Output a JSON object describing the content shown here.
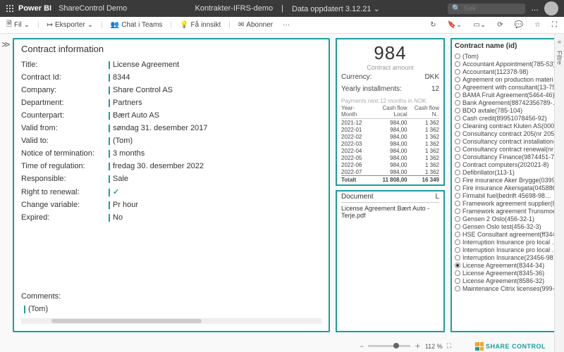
{
  "topbar": {
    "product": "Power BI",
    "workspace": "ShareControl Demo",
    "report_name": "Kontrakter-IFRS-demo",
    "data_updated_label": "Data oppdatert 3.12.21",
    "search_placeholder": "Søk",
    "more": "…"
  },
  "toolbar": {
    "file": "Fil",
    "export": "Eksporter",
    "chat": "Chat i Teams",
    "insight": "Få innsikt",
    "subscribe": "Abonner",
    "more": "···"
  },
  "contract_info": {
    "heading": "Contract information",
    "fields": [
      {
        "label": "Title:",
        "value": "License Agreement"
      },
      {
        "label": "Contract Id:",
        "value": "8344"
      },
      {
        "label": "Company:",
        "value": "Share Control AS"
      },
      {
        "label": "Department:",
        "value": "Partners"
      },
      {
        "label": "Counterpart:",
        "value": "Bært Auto AS"
      },
      {
        "label": "Valid from:",
        "value": "søndag 31. desember 2017"
      },
      {
        "label": "Valid to:",
        "value": "(Tom)"
      },
      {
        "label": "Notice of termination:",
        "value": "3 months"
      },
      {
        "label": "Time of regulation:",
        "value": "fredag 30. desember 2022"
      },
      {
        "label": "Responsible:",
        "value": "Sale"
      },
      {
        "label": "Right to renewal:",
        "value": "✓",
        "isCheck": true
      },
      {
        "label": "Change variable:",
        "value": "Pr hour"
      },
      {
        "label": "Expired:",
        "value": "No"
      }
    ],
    "comments_label": "Comments:",
    "comments_value": "(Tom)"
  },
  "kpi": {
    "value": "984",
    "label": "Contract amount",
    "currency_label": "Currency:",
    "currency_value": "DKK",
    "installments_label": "Yearly installments:",
    "installments_value": "12",
    "table_caption": "Payments next 12 months in NOK",
    "columns": [
      "Year-Month",
      "Cash flow Local",
      "Cash flow N.."
    ],
    "rows": [
      {
        "ym": "2021-12",
        "local": "984,00",
        "nok": "1 362"
      },
      {
        "ym": "2022-01",
        "local": "984,00",
        "nok": "1 362"
      },
      {
        "ym": "2022-02",
        "local": "984,00",
        "nok": "1 362"
      },
      {
        "ym": "2022-03",
        "local": "984,00",
        "nok": "1 362"
      },
      {
        "ym": "2022-04",
        "local": "984,00",
        "nok": "1 362"
      },
      {
        "ym": "2022-05",
        "local": "984,00",
        "nok": "1 362"
      },
      {
        "ym": "2022-06",
        "local": "984,00",
        "nok": "1 362"
      },
      {
        "ym": "2022-07",
        "local": "984,00",
        "nok": "1 362"
      }
    ],
    "total_label": "Totalt",
    "total_local": "11 808,00",
    "total_nok": "16 349"
  },
  "documents": {
    "header": "Document",
    "col2": "L",
    "items": [
      "License Agreement Bært Auto - Terje.pdf"
    ]
  },
  "slicer": {
    "title": "Contract name (id)",
    "items": [
      {
        "label": "(Tom)"
      },
      {
        "label": "Accountant Appointment(785-53)"
      },
      {
        "label": "Accountant(112378-98)"
      },
      {
        "label": "Agreement on production materi…"
      },
      {
        "label": "Agreement with consultant(13-75)"
      },
      {
        "label": "BAMA Fruit Agreement(5464-46)"
      },
      {
        "label": "Bank Agreement(88742356789-…"
      },
      {
        "label": "BDO avtale(785-104)"
      },
      {
        "label": "Cash credit(89951078456-92)"
      },
      {
        "label": "Cleaning contract Kluten AS(000…"
      },
      {
        "label": "Consultancy contract 205(nr 205…"
      },
      {
        "label": "Consultancy contract installation(…"
      },
      {
        "label": "Consultancy contract renewal(nr …"
      },
      {
        "label": "Consultancy Finance(9874451-79)"
      },
      {
        "label": "Contract computers(202021-8)"
      },
      {
        "label": "Defibrillator(113-1)"
      },
      {
        "label": "Fire insurance Aker Brygge(0399…"
      },
      {
        "label": "Fire insurance Akersgata(045886…"
      },
      {
        "label": "Firmabil fuel|bedrift 45698-98…"
      },
      {
        "label": "Framework agreement supplier(8…"
      },
      {
        "label": "Framework agreement Trunsmoe…"
      },
      {
        "label": "Gensen 2 Oslo(456-32-1)"
      },
      {
        "label": "Gensen Oslo test(456-32-3)"
      },
      {
        "label": "HSE Consultant agreement(ff344…"
      },
      {
        "label": "Interruption Insurance pro local …"
      },
      {
        "label": "Interruption Insurance pro local …"
      },
      {
        "label": "Interruption Insurance(23456-98…"
      },
      {
        "label": "License Agreement(8344-34)",
        "selected": true
      },
      {
        "label": "License Agreement(8345-36)"
      },
      {
        "label": "License Agreement(8586-32)"
      },
      {
        "label": "Maintenance Citrix licenses(999-…"
      }
    ]
  },
  "side": {
    "filters": "Filtre"
  },
  "footer": {
    "brand": "SHARE CONTROL",
    "zoom": "112 %"
  }
}
